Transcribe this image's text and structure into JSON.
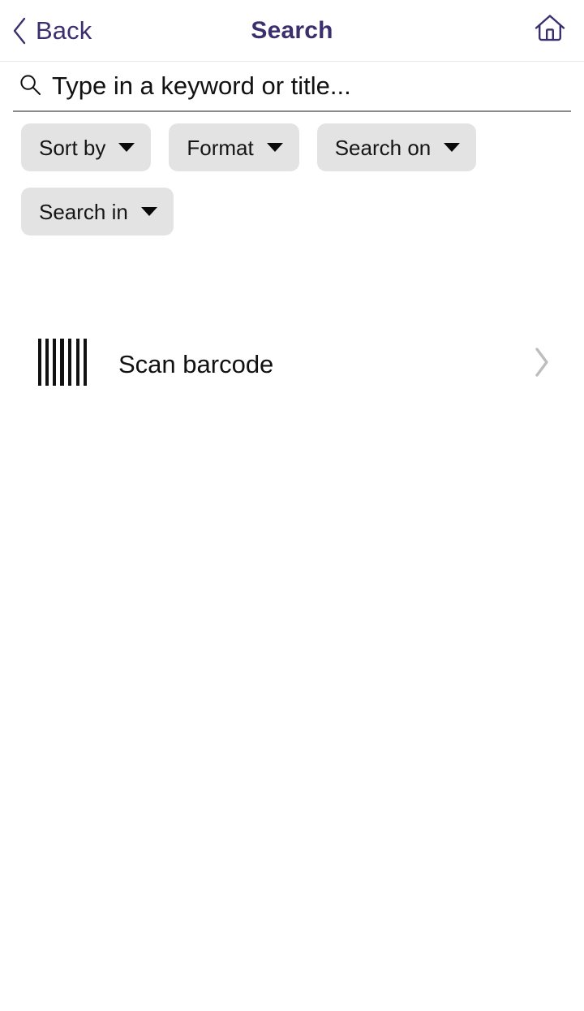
{
  "theme": {
    "accent": "#3b2f6e",
    "chip_bg": "#e3e3e3",
    "text": "#111111",
    "muted": "#b8b8b8",
    "divider": "#e8e8ec",
    "input_underline": "#8b8b8f",
    "background": "#ffffff"
  },
  "header": {
    "back_label": "Back",
    "back_icon": "chevron-left-icon",
    "title": "Search",
    "home_icon": "home-icon"
  },
  "search": {
    "icon": "search-icon",
    "value": "",
    "placeholder": "Type in a keyword or title..."
  },
  "filters": {
    "caret_icon": "caret-down-icon",
    "chips": [
      {
        "label": "Sort by",
        "selected": ""
      },
      {
        "label": "Format",
        "selected": ""
      },
      {
        "label": "Search on",
        "selected": ""
      },
      {
        "label": "Search in",
        "selected": ""
      }
    ]
  },
  "scan": {
    "icon": "barcode-icon",
    "label": "Scan barcode",
    "chevron_icon": "chevron-right-icon",
    "bar_count": 7
  },
  "results": {
    "items": []
  }
}
